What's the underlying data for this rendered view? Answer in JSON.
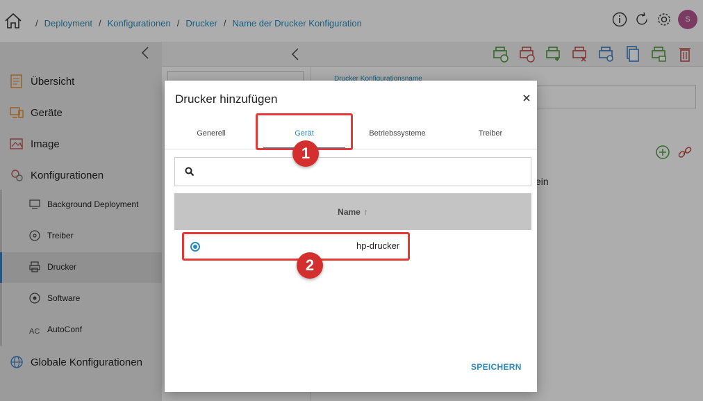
{
  "breadcrumb": {
    "items": [
      "Deployment",
      "Konfigurationen",
      "Drucker",
      "Name der Drucker Konfiguration"
    ],
    "separator": "/"
  },
  "header": {
    "avatar_initial": "S"
  },
  "sidebar": {
    "items": [
      {
        "label": "Übersicht",
        "icon": "overview-icon"
      },
      {
        "label": "Geräte",
        "icon": "devices-icon"
      },
      {
        "label": "Image",
        "icon": "image-icon"
      },
      {
        "label": "Konfigurationen",
        "icon": "configurations-icon"
      }
    ],
    "sub_items": [
      {
        "label": "Background Deployment",
        "icon": "background-deployment-icon"
      },
      {
        "label": "Treiber",
        "icon": "driver-icon"
      },
      {
        "label": "Drucker",
        "icon": "printer-icon",
        "active": true
      },
      {
        "label": "Software",
        "icon": "software-icon"
      },
      {
        "label": "AutoConf",
        "icon": "autoconf-icon"
      }
    ],
    "global_item": {
      "label": "Globale Konfigurationen",
      "icon": "global-config-icon"
    }
  },
  "main": {
    "field_label": "Drucker Konfigurationsname",
    "partial_text": "ein"
  },
  "dialog": {
    "title": "Drucker hinzufügen",
    "tabs": [
      "Generell",
      "Gerät",
      "Betriebssysteme",
      "Treiber"
    ],
    "active_tab": "Gerät",
    "search_value": "",
    "table_header": "Name",
    "sort_indicator": "↑",
    "rows": [
      {
        "name": "hp-drucker",
        "selected": true
      }
    ],
    "save_label": "SPEICHERN"
  },
  "annotations": [
    "1",
    "2"
  ],
  "colors": {
    "accent": "#2a8ab8",
    "highlight": "#e53935",
    "badge": "#d32f2f",
    "avatar": "#b5568f",
    "sidebar_bg": "#e5e5e5",
    "table_header_bg": "#c4c4c4"
  }
}
